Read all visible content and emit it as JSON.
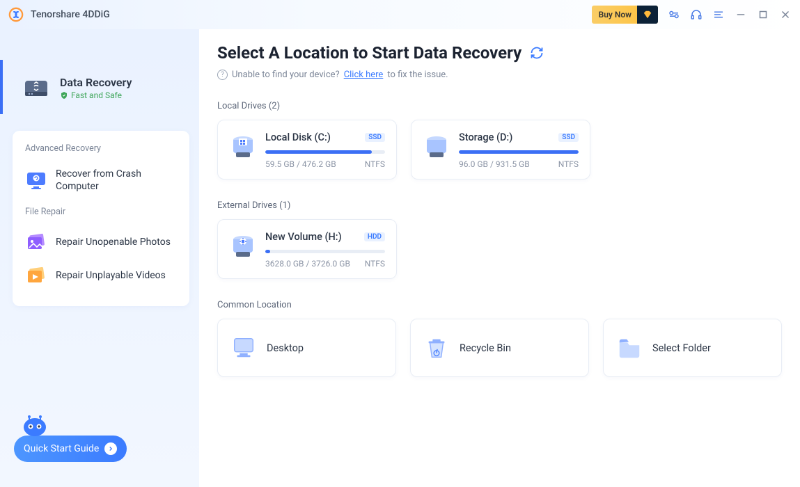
{
  "app": {
    "title": "Tenorshare 4DDiG",
    "buy_now": "Buy Now"
  },
  "sidebar": {
    "primary": {
      "title": "Data Recovery",
      "subtitle": "Fast and Safe"
    },
    "advanced_head": "Advanced Recovery",
    "file_repair_head": "File Repair",
    "items": [
      {
        "label": "Recover from Crash Computer"
      },
      {
        "label": "Repair Unopenable Photos"
      },
      {
        "label": "Repair Unplayable Videos"
      }
    ],
    "quick_start": "Quick Start Guide"
  },
  "content": {
    "title": "Select A Location to Start Data Recovery",
    "hint_pre": "Unable to find your device?",
    "hint_link": "Click here",
    "hint_post": "to fix the issue.",
    "local_head": "Local Drives (2)",
    "external_head": "External Drives (1)",
    "common_head": "Common Location",
    "local_drives": [
      {
        "name": "Local Disk (C:)",
        "tag": "SSD",
        "used": "59.5 GB / 476.2 GB",
        "fs": "NTFS",
        "pct": 89
      },
      {
        "name": "Storage (D:)",
        "tag": "SSD",
        "used": "96.0 GB / 931.5 GB",
        "fs": "NTFS",
        "pct": 100
      }
    ],
    "external_drives": [
      {
        "name": "New Volume (H:)",
        "tag": "HDD",
        "used": "3628.0 GB / 3726.0 GB",
        "fs": "NTFS",
        "pct": 4
      }
    ],
    "locations": [
      {
        "label": "Desktop"
      },
      {
        "label": "Recycle Bin"
      },
      {
        "label": "Select Folder"
      }
    ]
  }
}
